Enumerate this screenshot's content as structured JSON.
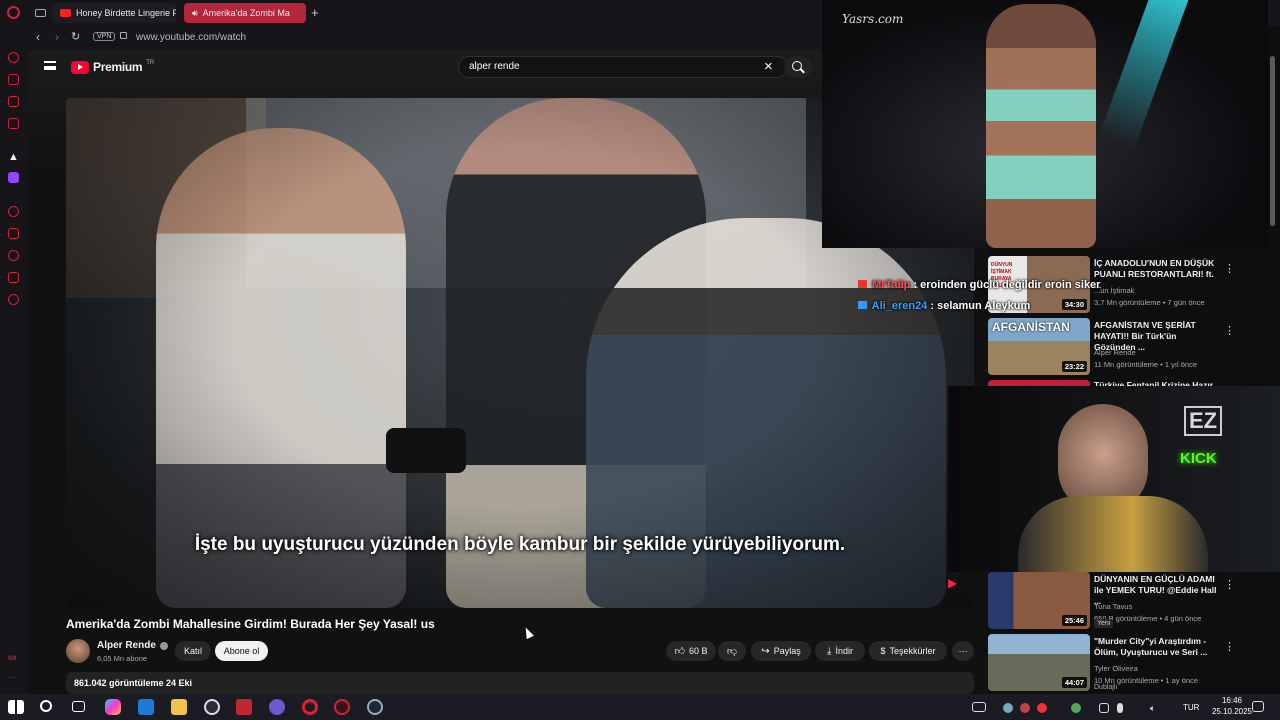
{
  "browser": {
    "tabs": [
      {
        "label": "Honey Birdette Lingerie F"
      },
      {
        "label": "Amerika'da Zombi Ma"
      }
    ],
    "new_tab": "+",
    "vpn_label": "VPN",
    "url": "www.youtube.com/watch"
  },
  "youtube": {
    "logo_text": "Premium",
    "logo_region": "TR",
    "search_value": "alper rende",
    "video_title": "Amerika'da Zombi Mahallesine Girdim! Burada Her Şey Yasal! us",
    "subtitle": "İşte bu uyuşturucu yüzünden böyle kambur bir şekilde yürüyebiliyorum.",
    "channel": {
      "name": "Alper Rende",
      "subs": "6,05 Mn abone"
    },
    "buttons": {
      "join": "Katıl",
      "subscribe": "Abone ol",
      "likes": "60 B",
      "share": "Paylaş",
      "download": "İndir",
      "thanks": "Teşekkürler"
    },
    "description": "861.042 görüntüleme  24 Eki"
  },
  "overlays": {
    "fashion_watermark": "Yasrs.com",
    "kick_text": "KICK",
    "ez_text": "EZ",
    "chat": [
      {
        "user": "MrTalip",
        "message": ": eroinden güclü değildir eroin siker"
      },
      {
        "user": "Ali_eren24",
        "message": ": selamun Aleykum"
      }
    ]
  },
  "recommendations": [
    {
      "title": "İÇ ANADOLU'NUN EN DÜŞÜK PUANLI RESTORANTLARI! ft. ...",
      "channel": "...un İştimak",
      "meta": "3,7 Mn görüntüleme • 7 gün önce",
      "duration": "34:30",
      "thumb_text": "DÜNYUN İŞTİMAK BURAYA GELDİM"
    },
    {
      "title": "AFGANİSTAN VE ŞERİAT HAYATI!! Bir Türk'ün Gözünden ...",
      "channel": "Alper Rende",
      "meta": "11 Mn görüntüleme • 1 yıl önce",
      "duration": "23:22",
      "thumb_text": "AFGANİSTAN"
    },
    {
      "title": "Türkiye Fentanil Krizine Hazır ...",
      "channel": "",
      "meta": "",
      "duration": "",
      "thumb_text": ""
    },
    {
      "title": "DÜNYANIN EN GÜÇLÜ ADAMI ile YEMEK TURU! @Eddie Hall ...",
      "channel": "Tuna Tavus",
      "meta": "650 B görüntüleme • 4 gün önce",
      "duration": "25:46",
      "badge": "Yeni",
      "thumb_text": ""
    },
    {
      "title": "\"Murder City\"yi Araştırdım - Ölüm, Uyuşturucu ve Seri ...",
      "channel": "Tyler Oliveira",
      "meta": "10 Mn görüntüleme • 1 ay önce",
      "duration": "44:07",
      "badge": "Dublajlı",
      "thumb_text": ""
    }
  ],
  "taskbar": {
    "lang": "TUR",
    "time": "16:46",
    "date": "25.10.2025"
  },
  "colors": {
    "accent": "#ff0033",
    "opera": "#d0243a",
    "kick": "#53fc18"
  }
}
